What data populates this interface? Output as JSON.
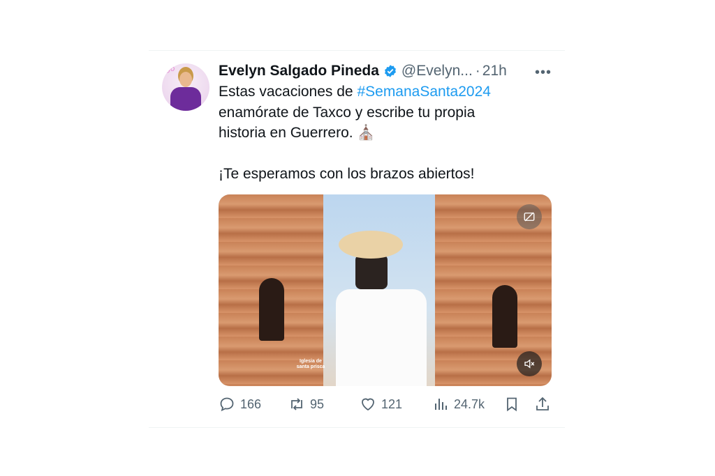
{
  "tweet": {
    "author_name": "Evelyn Salgado Pineda",
    "handle": "@Evelyn...",
    "separator": "·",
    "time": "21h",
    "more_label": "•••",
    "text_line1_prefix": "Estas vacaciones de ",
    "hashtag": "#SemanaSanta2024",
    "text_line2": "enamórate de Taxco y escribe tu propia",
    "text_line3": "historia en Guerrero. ⛪",
    "text_line4": "¡Te esperamos con los brazos abiertos!",
    "media": {
      "overlay_label": "Iglesia de santa prisca"
    }
  },
  "actions": {
    "replies": "166",
    "retweets": "95",
    "likes": "121",
    "views": "24.7k"
  },
  "colors": {
    "hashtag": "#1d9bf0",
    "verified": "#1d9bf0",
    "muted_text": "#536471"
  },
  "icons": {
    "reply": "reply-icon",
    "retweet": "retweet-icon",
    "like": "heart-icon",
    "views": "views-icon",
    "bookmark": "bookmark-icon",
    "share": "share-icon",
    "captions": "captions-icon",
    "mute": "mute-icon"
  }
}
